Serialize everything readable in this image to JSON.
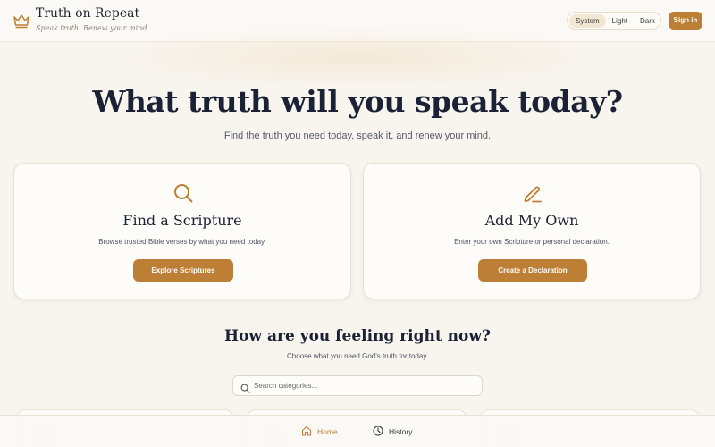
{
  "header": {
    "title": "Truth on Repeat",
    "tagline": "Speak truth. Renew your mind.",
    "logo_icon": "crown-icon",
    "theme_options": [
      "System",
      "Light",
      "Dark"
    ],
    "selected_theme": "System",
    "signin_label": "Sign in"
  },
  "hero": {
    "title": "What truth will you speak today?",
    "subtitle": "Find the truth you need today, speak it, and renew your mind."
  },
  "cards": [
    {
      "icon": "search-icon",
      "title": "Find a Scripture",
      "description": "Browse trusted Bible verses by what you need today.",
      "button_label": "Explore Scriptures"
    },
    {
      "icon": "pencil-icon",
      "title": "Add My Own",
      "description": "Enter your own Scripture or personal declaration.",
      "button_label": "Create a Declaration"
    }
  ],
  "feelings": {
    "title": "How are you feeling right now?",
    "subtitle": "Choose what you need God's truth for today.",
    "search_placeholder": "Search categories...",
    "search_value": ""
  },
  "bottom_nav": {
    "items": [
      {
        "label": "Home",
        "icon": "home-icon",
        "active": true
      },
      {
        "label": "History",
        "icon": "clock-icon",
        "active": false
      }
    ]
  },
  "colors": {
    "accent": "#bd7f35",
    "background": "#f8f5ef",
    "heading": "#1c2235"
  }
}
